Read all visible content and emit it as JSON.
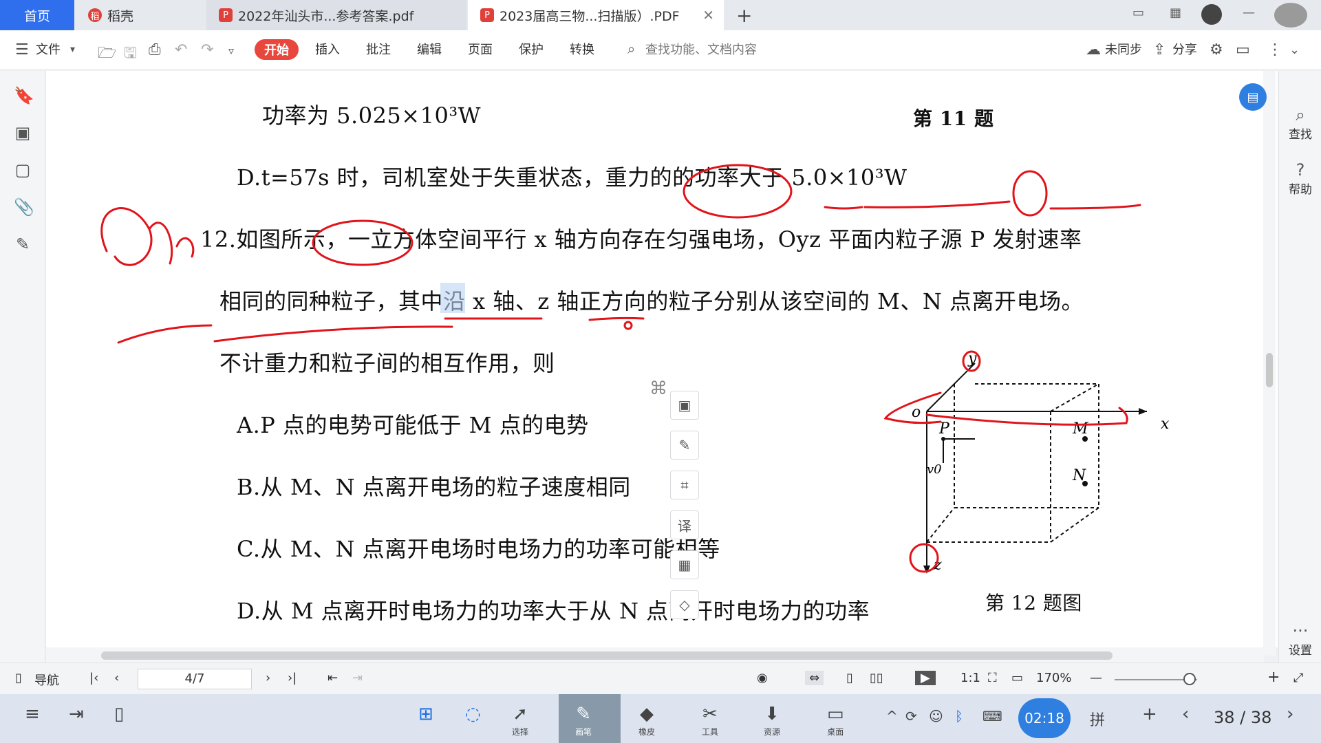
{
  "tabs": {
    "home": "首页",
    "app": "稻壳",
    "doc1": "2022年汕头市...参考答案.pdf",
    "doc2": "2023届高三物...扫描版）.PDF"
  },
  "toolbar": {
    "file": "文件",
    "start": "开始",
    "insert": "插入",
    "annotate": "批注",
    "edit": "编辑",
    "page": "页面",
    "protect": "保护",
    "convert": "转换",
    "search_placeholder": "查找功能、文档内容",
    "unsync": "未同步",
    "share": "分享"
  },
  "rightbar": {
    "find": "查找",
    "help": "帮助",
    "settings": "设置"
  },
  "document": {
    "l1": "功率为 5.025×10³W",
    "l1_label": "第 11 题",
    "l2": "D.t=57s 时，司机室处于失重状态，重力的的功率大于 5.0×10³W",
    "l3": "12.如图所示，一立方体空间平行 x 轴方向存在匀强电场，Oyz 平面内粒子源 P 发射速率",
    "l4": "相同的同种粒子，其中沿 x 轴、z 轴正方向的粒子分别从该空间的 M、N 点离开电场。",
    "l5": "不计重力和粒子间的相互作用，则",
    "optA": "A.P 点的电势可能低于 M 点的电势",
    "optB": "B.从 M、N 点离开电场的粒子速度相同",
    "optC": "C.从 M、N 点离开电场时电场力的功率可能相等",
    "optD": "D.从 M 点离开时电场力的功率大于从 N 点离开时电场力的功率",
    "fig_caption": "第 12 题图",
    "fig_labels": {
      "y": "y",
      "o": "o",
      "x": "x",
      "z": "z",
      "P": "P",
      "M": "M",
      "N": "N",
      "v0": "v0"
    }
  },
  "statusbar": {
    "nav": "导航",
    "page": "4/7",
    "zoom": "170%"
  },
  "taskbar": {
    "select": "选择",
    "pen": "画笔",
    "eraser": "橡皮",
    "tools": "工具",
    "resources": "资源",
    "desktop": "桌面",
    "time": "02:18",
    "ime": "拼",
    "pages": "38 / 38"
  },
  "colors": {
    "accent": "#2f6fed",
    "start_button": "#e8473d",
    "ink": "#e0141a"
  }
}
